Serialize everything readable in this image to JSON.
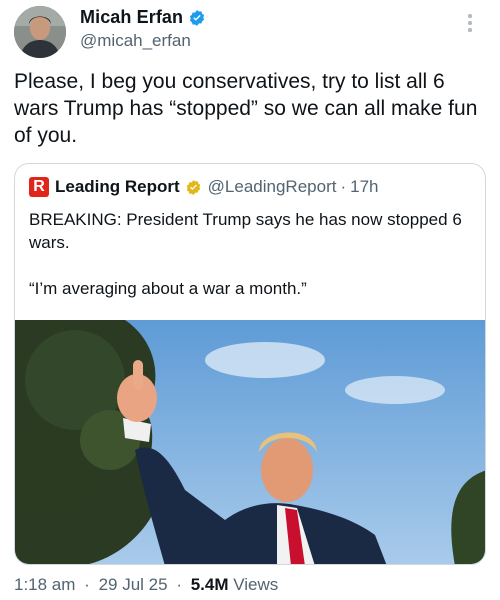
{
  "author": {
    "name": "Micah Erfan",
    "handle": "@micah_erfan"
  },
  "tweet": {
    "text": "Please, I beg you conservatives, try to list all 6 wars Trump has “stopped” so we can all make fun of you."
  },
  "quote": {
    "logo_letter": "R",
    "name": "Leading Report",
    "handle": "@LeadingReport",
    "separator": "·",
    "time": "17h",
    "line1": "BREAKING: President Trump says he has now stopped 6 wars.",
    "line2": "“I’m averaging about a war a month.”"
  },
  "meta": {
    "time": "1:18 am",
    "sep1": "·",
    "date": "29 Jul 25",
    "sep2": "·",
    "views_count": "5.4M",
    "views_label": "Views"
  },
  "colors": {
    "verified_blue": "#1d9bf0",
    "gold_badge": "#e2b719",
    "brand_red": "#e0251b",
    "secondary_text": "#536471"
  },
  "icons": {
    "author_verified": "verified-badge-icon",
    "quote_verified": "gold-verified-badge-icon",
    "more": "more-options-icon"
  }
}
